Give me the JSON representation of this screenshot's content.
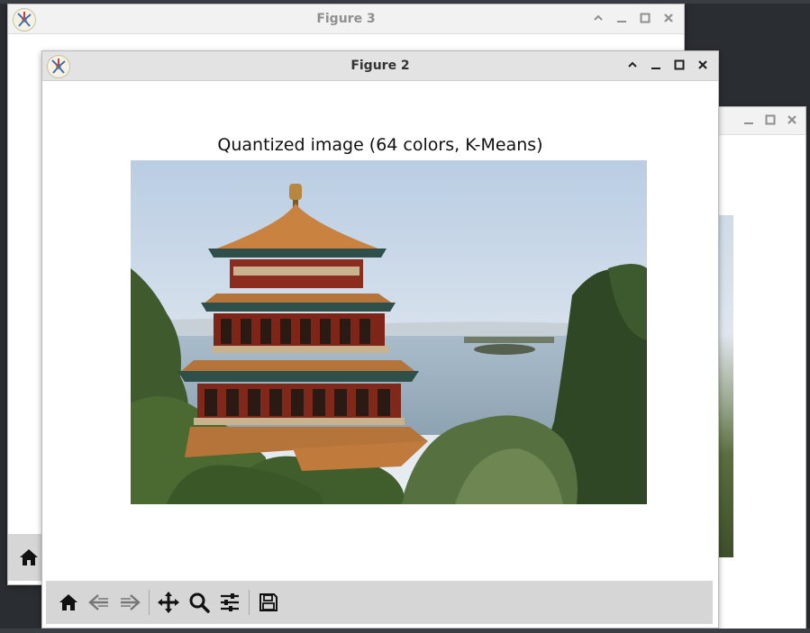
{
  "windows": {
    "figure3": {
      "title": "Figure 3"
    },
    "figure2": {
      "title": "Figure 2",
      "plot_title": "Quantized image (64 colors, K-Means)"
    }
  },
  "window_controls": [
    "chevron-up-icon",
    "minimize-icon",
    "maximize-icon",
    "close-icon"
  ],
  "toolbar": {
    "buttons": [
      "home-icon",
      "back-icon",
      "forward-icon",
      "pan-icon",
      "zoom-icon",
      "configure-subplots-icon",
      "save-icon"
    ]
  },
  "colors": {
    "titlebar_active": "#e3e3e3",
    "titlebar_inactive": "#f2f2f2",
    "toolbar_bg": "#d6d6d6",
    "desktop_bg": "#2a2d31"
  }
}
